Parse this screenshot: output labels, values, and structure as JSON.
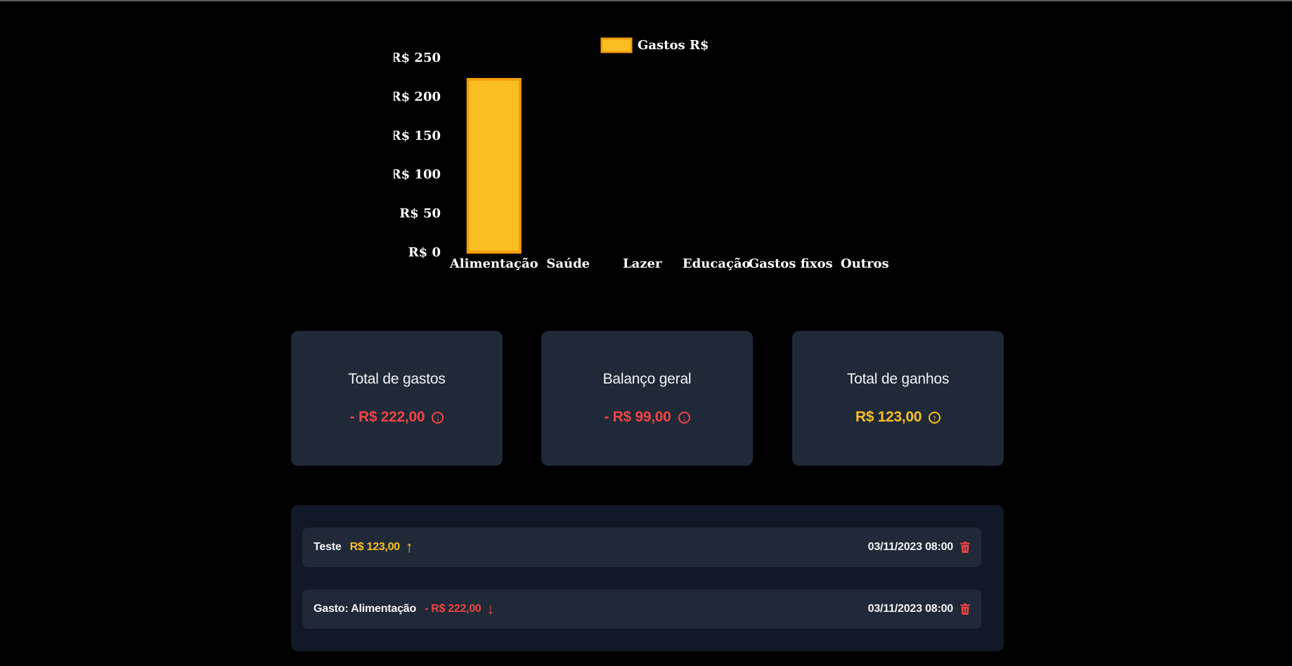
{
  "chart_data": {
    "type": "bar",
    "legend": "Gastos R$",
    "categories": [
      "Alimentação",
      "Saúde",
      "Lazer",
      "Educação",
      "Gastos fixos",
      "Outros"
    ],
    "values": [
      222,
      0,
      0,
      0,
      0,
      0
    ],
    "ylim": [
      0,
      250
    ],
    "yticks": [
      0,
      50,
      100,
      150,
      200,
      250
    ],
    "ytick_labels": [
      "R$ 0",
      "R$ 50",
      "R$ 100",
      "R$ 150",
      "R$ 200",
      "R$ 250"
    ],
    "bar_color": "#fbbf24",
    "bar_border_color": "#f59e0b",
    "legend_placement": "top-center",
    "grid": false
  },
  "cards": [
    {
      "title": "Total de gastos",
      "value": "- R$ 222,00",
      "icon": "arrow-down-circle-icon"
    },
    {
      "title": "Balanço geral",
      "value": "- R$ 99,00",
      "icon": "arrow-down-circle-icon"
    },
    {
      "title": "Total de ganhos",
      "value": "R$ 123,00",
      "icon": "arrow-up-circle-icon"
    }
  ],
  "transactions": [
    {
      "description": "Teste",
      "amount": "R$ 123,00",
      "direction": "up",
      "date": "03/11/2023 08:00"
    },
    {
      "description": "Gasto: Alimentação",
      "amount": "- R$ 222,00",
      "direction": "down",
      "date": "03/11/2023 08:00"
    }
  ],
  "colors": {
    "background": "#000000",
    "card": "#1f2937",
    "panel": "#111827",
    "negative": "#ef4444",
    "positive": "#fbbf24"
  }
}
